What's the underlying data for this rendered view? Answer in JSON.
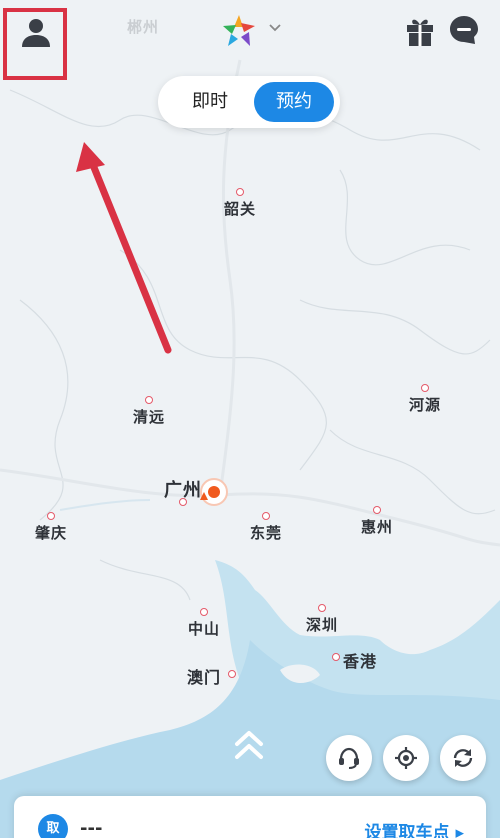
{
  "map": {
    "cities": [
      {
        "name": "郴州",
        "faded": true
      },
      {
        "name": "韶关"
      },
      {
        "name": "清远"
      },
      {
        "name": "河源"
      },
      {
        "name": "广州",
        "major": true
      },
      {
        "name": "肇庆"
      },
      {
        "name": "东莞"
      },
      {
        "name": "惠州"
      },
      {
        "name": "中山"
      },
      {
        "name": "深圳"
      },
      {
        "name": "香港"
      },
      {
        "name": "澳门"
      }
    ]
  },
  "header": {
    "profile_icon": "user-icon",
    "logo_icon": "app-logo-icon",
    "logo_dropdown_icon": "chevron-down-icon",
    "gift_icon": "gift-icon",
    "message_icon": "message-icon"
  },
  "mode_toggle": {
    "options": [
      "即时",
      "预约"
    ],
    "selected": "预约"
  },
  "controls": {
    "expand_icon": "double-chevron-up-icon",
    "support_icon": "headset-icon",
    "locate_icon": "crosshair-icon",
    "refresh_icon": "refresh-icon"
  },
  "pickup": {
    "badge": "取",
    "value": "---",
    "action": "设置取车点 ▸"
  },
  "colors": {
    "accent": "#1d88e5",
    "annotation": "#d93244",
    "location": "#f05a1e",
    "water": "#b9dcee"
  }
}
